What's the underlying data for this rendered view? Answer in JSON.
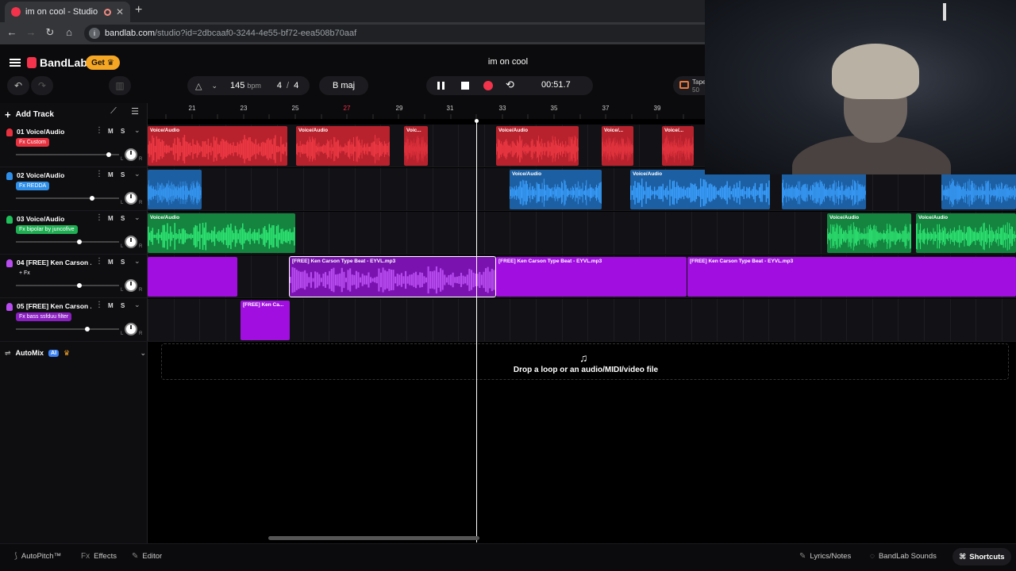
{
  "browser": {
    "tab_title": "im on cool - Studio",
    "url_host": "bandlab.com",
    "url_path": "/studio?id=2dbcaaf0-3244-4e55-bf72-eea508b70aaf"
  },
  "header": {
    "brand": "BandLab",
    "get_label": "Get",
    "project_title": "im on cool",
    "tempo": "145",
    "tempo_unit": "bpm",
    "time_sig_num": "4",
    "time_sig_den": "4",
    "key": "B maj",
    "time": "00:51.7",
    "tape_label": "Tape",
    "tape_value": "50"
  },
  "sidebar": {
    "add_track": "Add Track",
    "mute": "M",
    "solo": "S",
    "tracks": [
      {
        "number": "01",
        "name": "Voice/Audio",
        "fx": "Fx Custom",
        "color": "#e8313f",
        "fx_bg": "#e8313f",
        "volume": 0.92
      },
      {
        "number": "02",
        "name": "Voice/Audio",
        "fx": "Fx REDDA",
        "color": "#2f8fe8",
        "fx_bg": "#2f8fe8",
        "volume": 0.75
      },
      {
        "number": "03",
        "name": "Voice/Audio",
        "fx": "Fx bipolar by juncofive",
        "color": "#1fbf5a",
        "fx_bg": "#1fae52",
        "volume": 0.62
      },
      {
        "number": "04",
        "name": "[FREE] Ken Carson ...",
        "fx": "+ Fx",
        "color": "#b84cf0",
        "fx_bg": "transparent",
        "volume": 0.62
      },
      {
        "number": "05",
        "name": "[FREE] Ken Carson ...",
        "fx": "Fx bass ssfduu filter",
        "color": "#b84cf0",
        "fx_bg": "#8a1fc0",
        "volume": 0.7
      }
    ],
    "automix": "AutoMix",
    "ai": "AI"
  },
  "timeline": {
    "bars": [
      "21",
      "23",
      "25",
      "27",
      "29",
      "31",
      "33",
      "35",
      "37",
      "39"
    ],
    "highlight_bar": "27",
    "clips": {
      "voice": "Voice/Audio",
      "voice_short": "Voic...",
      "voice_short2": "Voice/...",
      "beat": "[FREE] Ken Carson Type Beat - EYVL.mp3",
      "beat_short": "[FREE] Ken Ca..."
    },
    "drop_text": "Drop a loop or an audio/MIDI/video file"
  },
  "footer": {
    "autopitch": "AutoPitch™",
    "effects": "Effects",
    "editor": "Editor",
    "lyrics": "Lyrics/Notes",
    "sounds": "BandLab Sounds",
    "shortcuts": "Shortcuts"
  },
  "icons": [
    "undo-icon",
    "redo-icon",
    "piano-icon",
    "metronome-icon",
    "chevron-down-icon",
    "pause-icon",
    "stop-icon",
    "record-icon",
    "loop-icon",
    "tape-icon",
    "menu-icon",
    "crown-icon",
    "plus-icon",
    "tuning-icon",
    "mixer-icon",
    "music-note-icon"
  ]
}
